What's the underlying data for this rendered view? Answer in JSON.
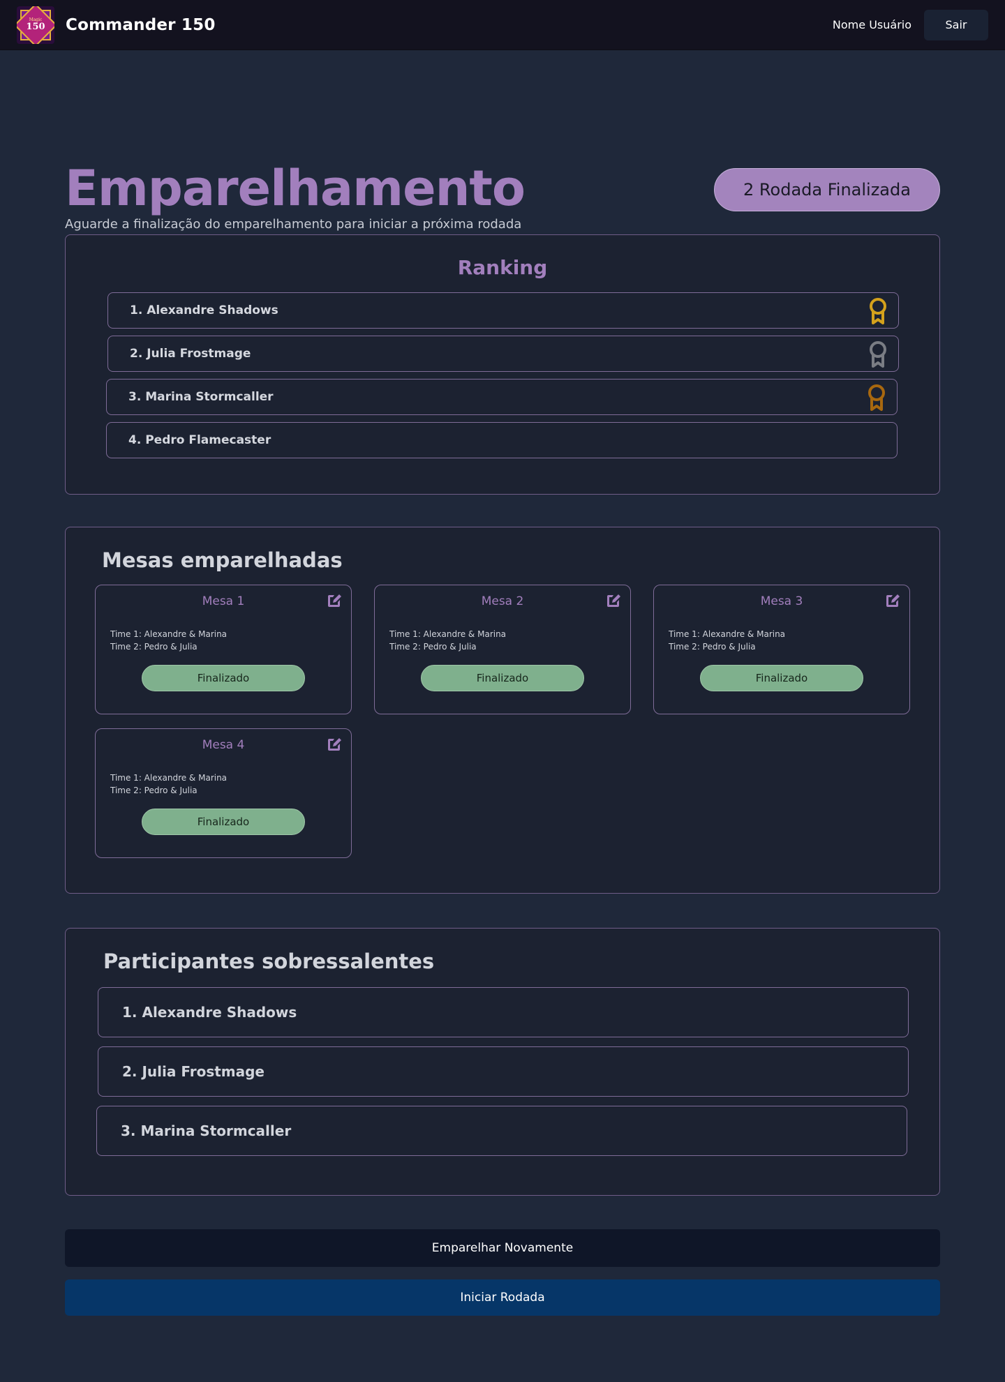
{
  "header": {
    "logo_text_top": "Magic",
    "logo_text_main": "150",
    "app_title": "Commander 150",
    "user_name": "Nome Usuário",
    "logout_label": "Sair"
  },
  "hero": {
    "title": "Emparelhamento",
    "subtitle": "Aguarde a finalização do emparelhamento para iniciar a próxima rodada",
    "round_status": "2 Rodada Finalizada"
  },
  "ranking": {
    "title": "Ranking",
    "entries": [
      {
        "label": "1. Alexandre Shadows",
        "medal": "gold",
        "medal_color": "#d4a11c"
      },
      {
        "label": "2. Julia Frostmage",
        "medal": "silver",
        "medal_color": "#7a7d84"
      },
      {
        "label": "3. Marina Stormcaller",
        "medal": "bronze",
        "medal_color": "#a8680f"
      },
      {
        "label": "4. Pedro Flamecaster",
        "medal": "none"
      }
    ]
  },
  "mesas": {
    "title": "Mesas emparelhadas",
    "tables": [
      {
        "name": "Mesa 1",
        "team1": "Time 1: Alexandre & Marina",
        "team2": "Time 2: Pedro & Julia",
        "status": "Finalizado"
      },
      {
        "name": "Mesa 2",
        "team1": "Time 1: Alexandre & Marina",
        "team2": "Time 2: Pedro & Julia",
        "status": "Finalizado"
      },
      {
        "name": "Mesa 3",
        "team1": "Time 1: Alexandre & Marina",
        "team2": "Time 2: Pedro & Julia",
        "status": "Finalizado"
      },
      {
        "name": "Mesa 4",
        "team1": "Time 1: Alexandre & Marina",
        "team2": "Time 2: Pedro & Julia",
        "status": "Finalizado"
      }
    ]
  },
  "reserves": {
    "title": "Participantes sobressalentes",
    "entries": [
      "1. Alexandre Shadows",
      "2. Julia Frostmage",
      "3. Marina Stormcaller"
    ]
  },
  "actions": {
    "repair_label": "Emparelhar Novamente",
    "start_label": "Iniciar Rodada"
  },
  "colors": {
    "accent": "#a27fbd",
    "status_done": "#7fb08d",
    "primary_button": "#063668"
  }
}
